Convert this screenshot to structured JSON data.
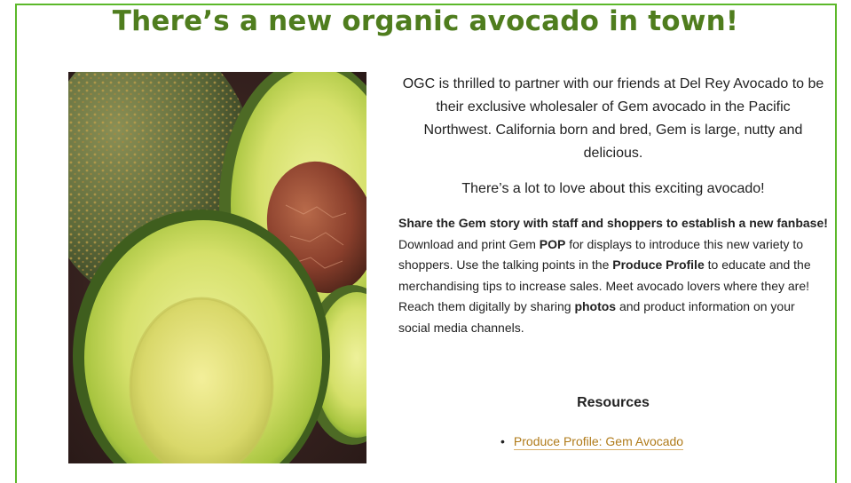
{
  "page": {
    "title": "There’s a new organic avocado in town!"
  },
  "intro": {
    "paragraph1": "OGC is thrilled to partner with our friends at Del Rey Avocado to be their exclusive wholesaler of Gem avocado in the Pacific Northwest. California born and bred, Gem is large, nutty and delicious.",
    "paragraph2": "There’s a lot to love about this exciting avocado!"
  },
  "body": {
    "bold1": "Share the Gem story with staff and shoppers to establish a new fanbase!",
    "text1": " Download and print Gem ",
    "bold2": "POP",
    "text2": " for displays to introduce this new variety to shoppers. Use the talking points in the ",
    "bold3": "Produce Profile",
    "text3": " to educate and the merchandising tips to increase sales. Meet avocado lovers where they are! Reach them digitally by sharing ",
    "bold4": "photos",
    "text4": " and product information on your social media channels."
  },
  "resources": {
    "heading": "Resources",
    "items": [
      {
        "label": "Produce Profile: Gem Avocado"
      }
    ]
  },
  "colors": {
    "title_green": "#4f7d1e",
    "frame_green": "#5cb82a",
    "link": "#b07b1a"
  }
}
